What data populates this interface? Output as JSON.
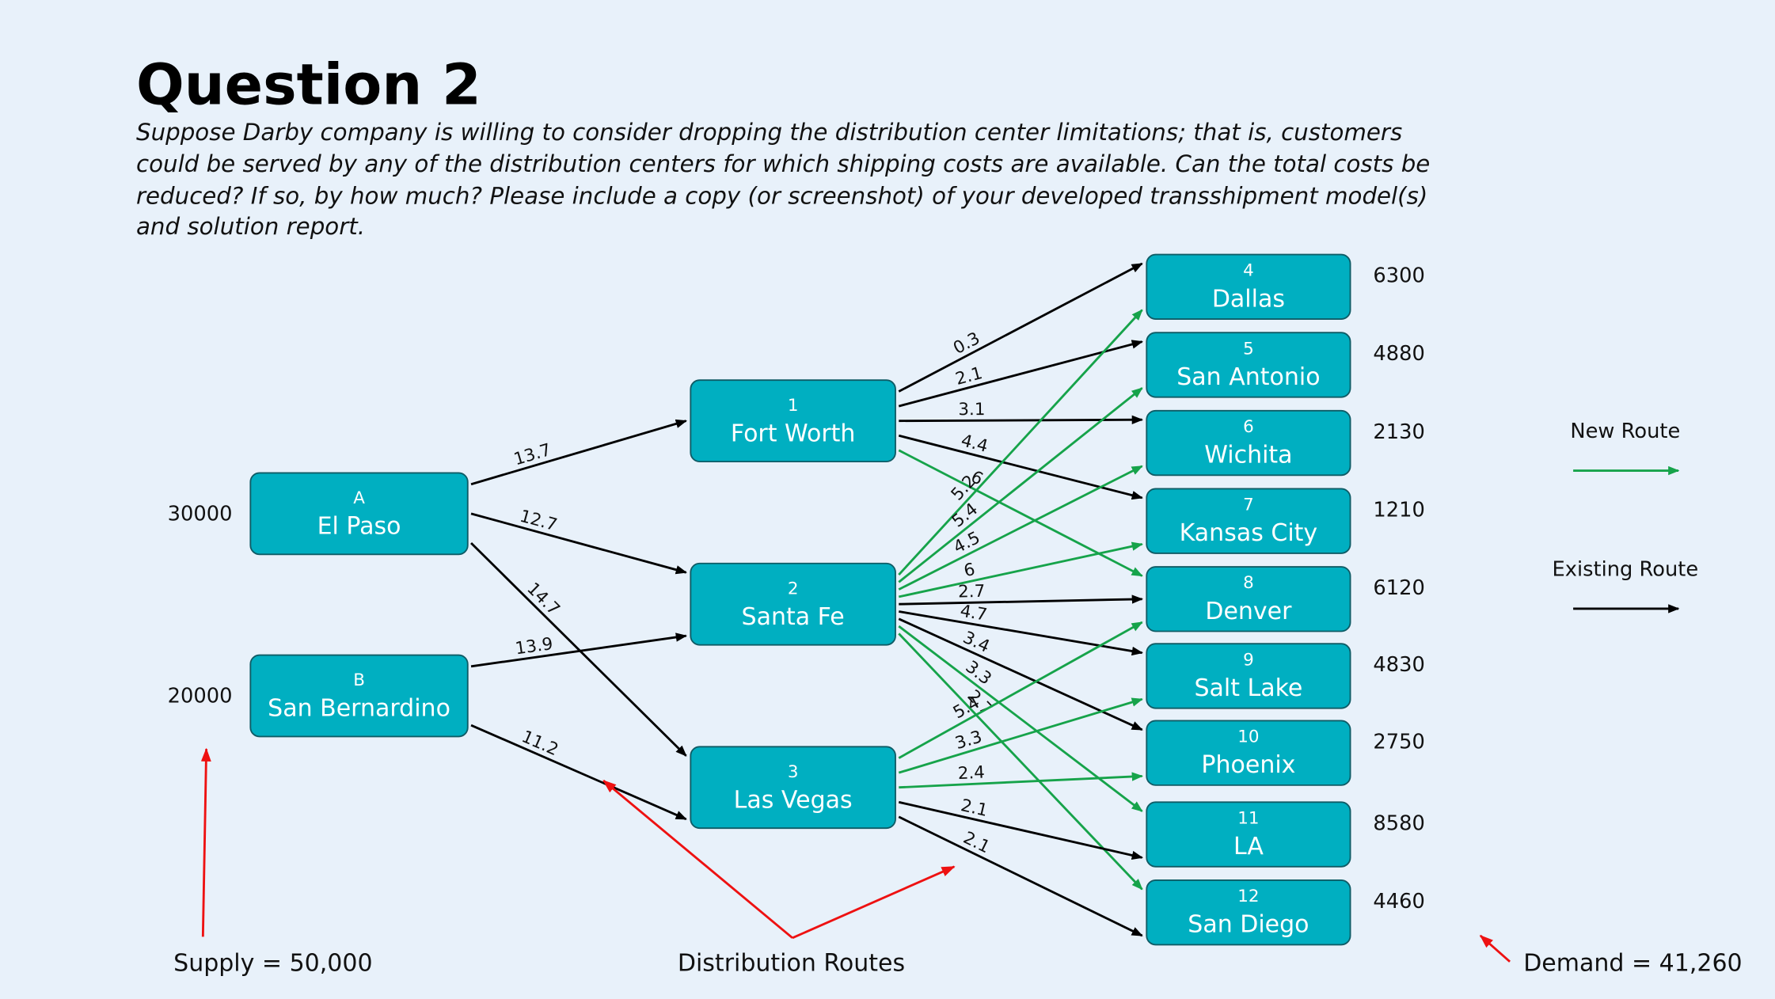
{
  "title": "Question 2",
  "question_lines": [
    "Suppose Darby company is willing to consider dropping the distribution center limitations; that is, customers",
    "could be served by any of the distribution centers for which shipping costs are available. Can the total costs be",
    "reduced? If so, by how much? Please include a copy (or screenshot) of your developed transshipment model(s)",
    "and solution report."
  ],
  "colors": {
    "node": "#00afc1",
    "new_route": "#16a34a",
    "existing_route": "#000000",
    "annotation": "#ee1111",
    "background": "#e8f1fa"
  },
  "nodes": [
    {
      "id": "A",
      "label": "El Paso",
      "value": "30000"
    },
    {
      "id": "B",
      "label": "San Bernardino",
      "value": "20000"
    },
    {
      "id": "1",
      "label": "Fort Worth"
    },
    {
      "id": "2",
      "label": "Santa Fe"
    },
    {
      "id": "3",
      "label": "Las Vegas"
    },
    {
      "id": "4",
      "label": "Dallas",
      "value": "6300"
    },
    {
      "id": "5",
      "label": "San Antonio",
      "value": "4880"
    },
    {
      "id": "6",
      "label": "Wichita",
      "value": "2130"
    },
    {
      "id": "7",
      "label": "Kansas City",
      "value": "1210"
    },
    {
      "id": "8",
      "label": "Denver",
      "value": "6120"
    },
    {
      "id": "9",
      "label": "Salt Lake",
      "value": "4830"
    },
    {
      "id": "10",
      "label": "Phoenix",
      "value": "2750"
    },
    {
      "id": "11",
      "label": "LA",
      "value": "8580"
    },
    {
      "id": "12",
      "label": "San Diego",
      "value": "4460"
    }
  ],
  "edges": [
    {
      "from": "A",
      "to": "1",
      "cost": "13.7",
      "type": "existing"
    },
    {
      "from": "A",
      "to": "2",
      "cost": "12.7",
      "type": "existing"
    },
    {
      "from": "A",
      "to": "3",
      "cost": "14.7",
      "type": "existing"
    },
    {
      "from": "B",
      "to": "2",
      "cost": "13.9",
      "type": "existing"
    },
    {
      "from": "B",
      "to": "3",
      "cost": "11.2",
      "type": "existing"
    },
    {
      "from": "1",
      "to": "4",
      "cost": "0.3",
      "type": "existing"
    },
    {
      "from": "1",
      "to": "5",
      "cost": "2.1",
      "type": "existing"
    },
    {
      "from": "1",
      "to": "6",
      "cost": "3.1",
      "type": "existing"
    },
    {
      "from": "1",
      "to": "7",
      "cost": "4.4",
      "type": "existing"
    },
    {
      "from": "1",
      "to": "8",
      "cost": "6",
      "type": "new"
    },
    {
      "from": "2",
      "to": "4",
      "cost": "5.2",
      "type": "new"
    },
    {
      "from": "2",
      "to": "5",
      "cost": "5.4",
      "type": "new"
    },
    {
      "from": "2",
      "to": "6",
      "cost": "4.5",
      "type": "new"
    },
    {
      "from": "2",
      "to": "7",
      "cost": "6",
      "type": "new"
    },
    {
      "from": "2",
      "to": "8",
      "cost": "2.7",
      "type": "existing"
    },
    {
      "from": "2",
      "to": "9",
      "cost": "4.7",
      "type": "existing"
    },
    {
      "from": "2",
      "to": "10",
      "cost": "3.4",
      "type": "existing"
    },
    {
      "from": "2",
      "to": "11",
      "cost": "3.3",
      "type": "new"
    },
    {
      "from": "2",
      "to": "12",
      "cost": "2.7",
      "type": "new"
    },
    {
      "from": "3",
      "to": "8",
      "cost": "5.4",
      "type": "new"
    },
    {
      "from": "3",
      "to": "9",
      "cost": "3.3",
      "type": "new"
    },
    {
      "from": "3",
      "to": "10",
      "cost": "2.4",
      "type": "new"
    },
    {
      "from": "3",
      "to": "11",
      "cost": "2.1",
      "type": "existing"
    },
    {
      "from": "3",
      "to": "12",
      "cost": "2.1",
      "type": "existing"
    }
  ],
  "legend": {
    "new_route": "New Route",
    "existing_route": "Existing Route"
  },
  "annotations": {
    "supply": "Supply = 50,000",
    "routes": "Distribution Routes",
    "demand": "Demand = 41,260"
  }
}
